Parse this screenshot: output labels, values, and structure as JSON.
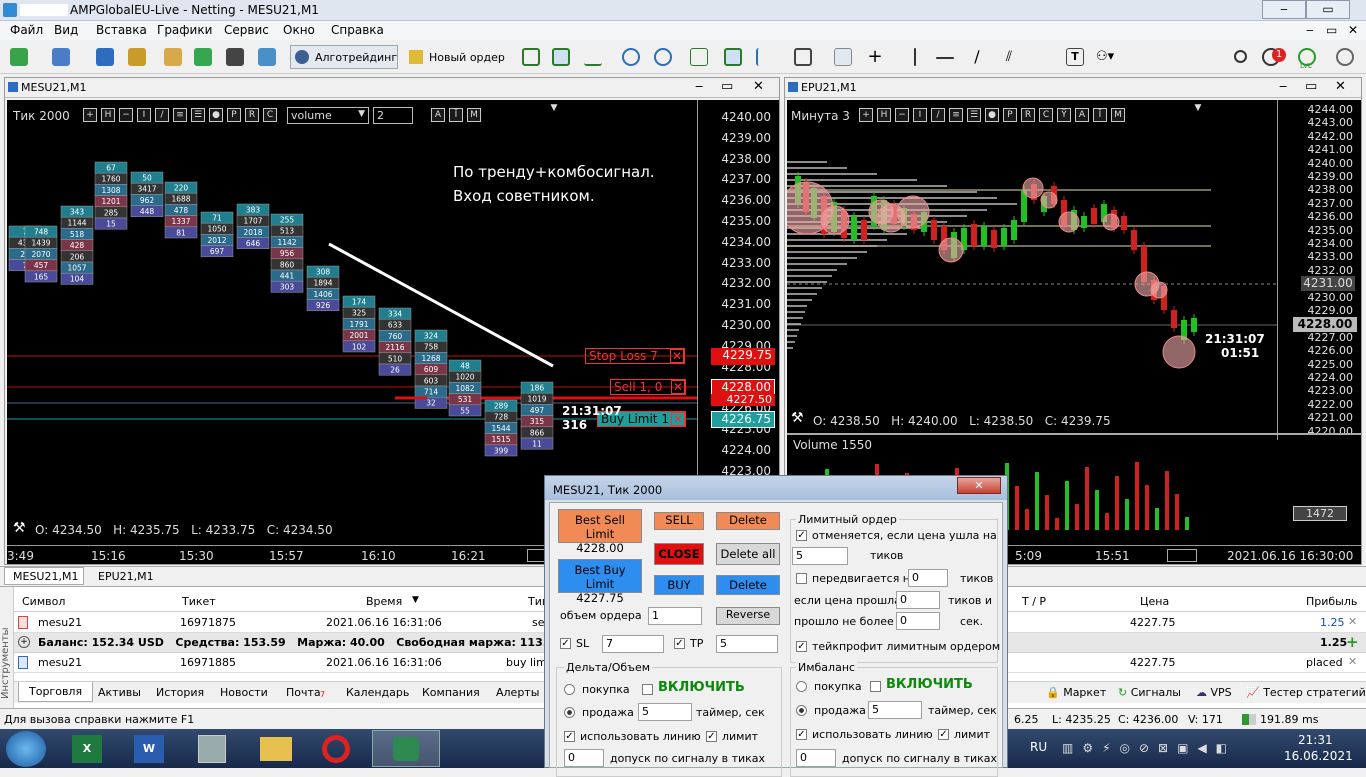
{
  "window": {
    "title": "AMPGlobalEU-Live - Netting - MESU21,M1"
  },
  "menu": [
    "Файл",
    "Вид",
    "Вставка",
    "Графики",
    "Сервис",
    "Окно",
    "Справка"
  ],
  "toolbar": {
    "algo": "Алготрейдинг",
    "new_order": "Новый ордер",
    "badge": "1",
    "lvl": "LVL"
  },
  "left_chart": {
    "title": "MESU21,M1",
    "mode": "Тик  2000",
    "volume_select": "volume",
    "spin": "2",
    "annotation": [
      "По тренду+комбосигнал.",
      "Вход советником."
    ],
    "ohlc": "O: 4234.50   H: 4235.75   L: 4233.75   C: 4234.50",
    "prices": [
      "4240.00",
      "4239.00",
      "4238.00",
      "4237.00",
      "4236.00",
      "4235.00",
      "4234.00",
      "4233.00",
      "4232.00",
      "4231.00",
      "4230.00",
      "4229.00",
      "4228.00",
      "4227.00",
      "4226.00",
      "4225.00",
      "4224.00",
      "4223.00"
    ],
    "times": [
      "3:49",
      "15:16",
      "15:30",
      "15:57",
      "16:10",
      "16:21"
    ],
    "stop_loss": "Stop Loss   7",
    "stop_loss_price": "4229.75",
    "sell": "Sell  1,  0",
    "sell_price": "4228.00",
    "sell_price2": "4227.50",
    "buy_limit": "Buy Limit  1",
    "buy_limit_price": "4226.75",
    "timer": "21:31:07",
    "timer_val": "316",
    "clusters": [
      [
        "7",
        "439",
        "20",
        "7"
      ],
      [
        "748",
        "1439",
        "2070",
        "457",
        "165"
      ],
      [
        "343",
        "1144",
        "518",
        "428",
        "206",
        "1057",
        "104"
      ],
      [
        "67",
        "1760",
        "1308",
        "1201",
        "285",
        "15"
      ],
      [
        "50",
        "3417",
        "962",
        "448"
      ],
      [
        "220",
        "1688",
        "478",
        "1337",
        "81"
      ],
      [
        "71",
        "1050",
        "2012",
        "697"
      ],
      [
        "383",
        "1707",
        "2018",
        "646"
      ],
      [
        "255",
        "513",
        "1142",
        "956",
        "860",
        "441",
        "303"
      ],
      [
        "308",
        "1894",
        "1406",
        "926"
      ],
      [
        "174",
        "325",
        "1791",
        "2001",
        "102"
      ],
      [
        "334",
        "633",
        "760",
        "2116",
        "510",
        "26"
      ],
      [
        "324",
        "758",
        "1268",
        "609",
        "603",
        "714",
        "32"
      ],
      [
        "48",
        "1020",
        "1082",
        "531",
        "55"
      ],
      [
        "289",
        "728",
        "1544",
        "1515",
        "399"
      ],
      [
        "186",
        "1019",
        "497",
        "315",
        "866",
        "11"
      ]
    ]
  },
  "right_chart": {
    "title": "EPU21,M1",
    "mode": "Минута  3",
    "ohlc": "O: 4238.50   H: 4240.00   L: 4238.50   C: 4239.75",
    "prices": [
      "4244.00",
      "4243.00",
      "4242.00",
      "4241.00",
      "4240.00",
      "4239.00",
      "4238.00",
      "4237.00",
      "4236.00",
      "4235.00",
      "4234.00",
      "4233.00",
      "4232.00",
      "4231.00",
      "4230.00",
      "4229.00",
      "4228.00",
      "4227.00",
      "4226.00",
      "4225.00",
      "4224.00",
      "4223.00",
      "4222.00",
      "4221.00",
      "4220.00"
    ],
    "last": "4231.00",
    "cur": "4228.00",
    "timer": "21:31:07",
    "timer2": "01:51",
    "volume_label": "Volume 1550",
    "vol_val": "1472",
    "times": [
      "5:09",
      "15:51",
      "2021.06.16 16:30:00"
    ]
  },
  "dialog": {
    "title": "MESU21, Тик  2000",
    "best_sell": "Best Sell Limit",
    "best_sell_price": "4228.00",
    "best_buy": "Best Buy Limit",
    "best_buy_price": "4227.75",
    "sell": "SELL",
    "close": "CLOSE",
    "buy": "BUY",
    "delete1": "Delete",
    "delete_all": "Delete all",
    "delete2": "Delete",
    "reverse": "Reverse",
    "volume_label": "объем ордера",
    "volume": "1",
    "sl": "SL",
    "sl_val": "7",
    "tp": "TP",
    "tp_val": "5",
    "limit_section": "Лимитный ордер",
    "cancel_text": "отменяется, если цена ушла на",
    "cancel_val": "5",
    "ticks": "тиков",
    "moves_text": "передвигается на",
    "moves_val": "0",
    "ticks2": "тиков",
    "passed_text": "если цена прошла",
    "passed_val": "0",
    "ticks3": "тиков и",
    "not_more": "прошло не более",
    "not_more_val": "0",
    "sec": "сек.",
    "tp_limit": "тейкпрофит лимитным ордером",
    "delta": "Дельта/Объем",
    "imbalance": "Имбаланс",
    "buy_r": "покупка",
    "sell_r": "продажа",
    "enable": "ВКЛЮЧИТЬ",
    "d_val": "5",
    "timer_lbl": "таймер, сек",
    "i_val": "5",
    "timer_lbl2": "таймер, сек",
    "use_line": "использовать линию",
    "limit": "лимит",
    "tol_val": "0",
    "tol": "допуск по сигналу в тиках",
    "tol_val2": "0",
    "tol2": "допуск по сигналу в тиках"
  },
  "terminal": {
    "chart_tabs": [
      "MESU21,M1",
      "EPU21,M1"
    ],
    "headers": [
      "Символ",
      "Тикет",
      "Время",
      "Тип",
      "Т / Р",
      "Цена",
      "Прибыль"
    ],
    "row1": {
      "sym": "mesu21",
      "ticket": "16971875",
      "time": "2021.06.16 16:31:06",
      "type": "se",
      "price": "4227.75",
      "profit": "1.25"
    },
    "balance": "Баланс: 152.34 USD   Средства: 153.59   Маржа: 40.00   Свободная маржа: 113.59   Уровень маржи",
    "balance_profit": "1.25",
    "row2": {
      "sym": "mesu21",
      "ticket": "16971885",
      "time": "2021.06.16 16:31:06",
      "type": "buy lim",
      "price": "4227.75",
      "profit": "placed"
    },
    "side_label": "Инструменты",
    "tabs": [
      "Торговля",
      "Активы",
      "История",
      "Новости",
      "Почта",
      "Календарь",
      "Компания",
      "Алерты"
    ],
    "mail_count": "7",
    "right_tabs": [
      "Маркет",
      "Сигналы",
      "VPS",
      "Тестер стратегий"
    ]
  },
  "status": {
    "help": "Для вызова справки нажмите F1",
    "s1": "6.25",
    "s2": "L: 4235.25",
    "s3": "C: 4236.00",
    "s4": "V: 171",
    "s5": "191.89 ms"
  },
  "taskbar": {
    "lang": "RU",
    "time": "21:31",
    "date": "16.06.2021"
  }
}
